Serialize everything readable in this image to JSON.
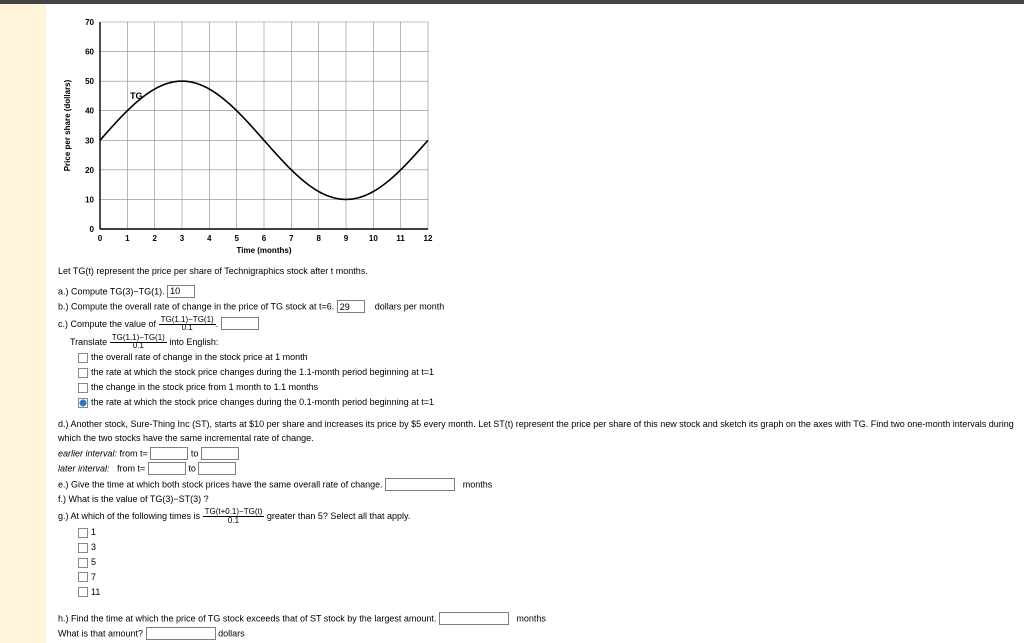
{
  "chart_data": {
    "type": "line",
    "title": "",
    "xlabel": "Time (months)",
    "ylabel": "Price per share (dollars)",
    "xlim": [
      0,
      12
    ],
    "ylim": [
      0,
      70
    ],
    "x_ticks": [
      0,
      1,
      2,
      3,
      4,
      5,
      6,
      7,
      8,
      9,
      10,
      11,
      12
    ],
    "y_ticks": [
      0,
      10,
      20,
      30,
      40,
      50,
      60,
      70
    ],
    "series_label": "TG",
    "x": [
      0,
      1,
      2,
      3,
      4,
      5,
      6,
      7,
      8,
      9,
      10,
      11,
      12
    ],
    "y": [
      30,
      40,
      48,
      50,
      48,
      40,
      30,
      20,
      12,
      10,
      12,
      20,
      30
    ]
  },
  "intro": "Let TG(t) represent the price per share of Technigraphics stock after t months.",
  "a": {
    "label": "a.) Compute TG(3)−TG(1).",
    "prefill": "10"
  },
  "b": {
    "label_pre": "b.) Compute the overall rate of change in the price of TG stock at t=6.",
    "prefill": "29",
    "unit": "dollars per month"
  },
  "c": {
    "label": "c.) Compute the value of",
    "num": "TG(1.1)−TG(1)",
    "den": "0.1",
    "suffix": "."
  },
  "translate": {
    "label": "Translate",
    "num": "TG(1.1)−TG(1)",
    "den": "0.1",
    "suffix": "into English:"
  },
  "opts": {
    "o1": "the overall rate of change in the stock price at 1 month",
    "o2": "the rate at which the stock price changes during the 1.1-month period beginning at t=1",
    "o3": "the change in the stock price from 1 month to 1.1 months",
    "o4": "the rate at which the stock price changes during the 0.1-month period beginning at t=1"
  },
  "d": {
    "text": "d.) Another stock, Sure-Thing Inc (ST), starts at $10 per share and increases its price by $5 every month. Let ST(t) represent the price per share of this new stock and sketch its graph on the axes with TG. Find two one-month intervals during which the two stocks have the same incremental rate of change."
  },
  "d_lines": {
    "early_lbl": "earlier interval:",
    "early_from": "from t=",
    "to": "to",
    "late_lbl": "later interval:",
    "late_from": "from t="
  },
  "e": {
    "label": "e.) Give the time at which both stock prices have the same overall rate of change.",
    "unit": "months"
  },
  "f": {
    "label": "f.) What is the value of TG(3)−ST(3) ?"
  },
  "g": {
    "label_pre": "g.) At which of the following times is",
    "num": "TG(t+0.1)−TG(t)",
    "den": "0.1",
    "label_post": "greater than 5? Select all that apply.",
    "v1": "1",
    "v2": "3",
    "v3": "5",
    "v4": "7",
    "v5": "11"
  },
  "h": {
    "label": "h.) Find the time at which the price of TG stock exceeds that of ST stock by the largest amount.",
    "unit": "months",
    "q2": "What is that amount?",
    "u2": "dollars"
  }
}
